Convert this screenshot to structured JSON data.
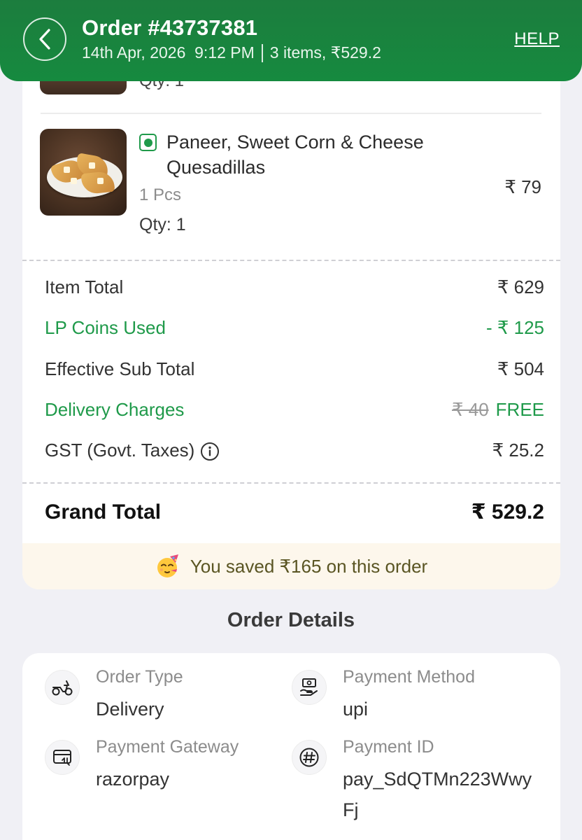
{
  "header": {
    "title": "Order #43737381",
    "datetime": "14th Apr, 2026  9:12 PM",
    "summary": "3 items, ₹529.2",
    "help": "HELP"
  },
  "previous_item": {
    "qty_partial": "Qty: 1"
  },
  "item": {
    "name": "Paneer, Sweet Corn & Cheese Quesadillas",
    "unit": "1 Pcs",
    "qty": "Qty: 1",
    "price": "₹ 79",
    "veg": true
  },
  "bill": {
    "item_total_label": "Item Total",
    "item_total_value": "₹ 629",
    "lp_label": "LP Coins Used",
    "lp_value": "- ₹ 125",
    "sub_label": "Effective Sub Total",
    "sub_value": "₹ 504",
    "delivery_label": "Delivery Charges",
    "delivery_original": "₹ 40",
    "delivery_value": "FREE",
    "gst_label": "GST (Govt. Taxes)",
    "gst_value": "₹ 25.2",
    "grand_label": "Grand Total",
    "grand_value": "₹ 529.2",
    "savings": "You saved ₹165 on this order"
  },
  "details": {
    "title": "Order Details",
    "order_type_label": "Order Type",
    "order_type_value": "Delivery",
    "payment_method_label": "Payment Method",
    "payment_method_value": "upi",
    "gateway_label": "Payment Gateway",
    "gateway_value": "razorpay",
    "payment_id_label": "Payment ID",
    "payment_id_value": "pay_SdQTMn223WwyFj"
  },
  "colors": {
    "header_green": "#1c7d3e",
    "accent_green": "#1f9a4a",
    "savings_bg": "#fdf7ec"
  },
  "icons": [
    "chevron-left-icon",
    "veg-indicator-icon",
    "info-icon",
    "party-face-icon",
    "scooter-icon",
    "cash-hand-icon",
    "card-transfer-icon",
    "hash-icon"
  ]
}
